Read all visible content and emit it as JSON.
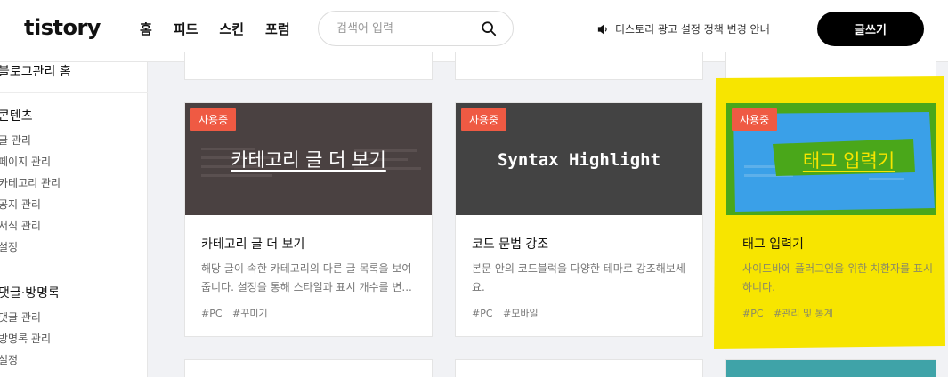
{
  "header": {
    "logo": "tistory",
    "nav": [
      "홈",
      "피드",
      "스킨",
      "포럼"
    ],
    "search_placeholder": "검색어 입력",
    "notice": "티스토리 광고 설정 정책 변경 안내",
    "write_label": "글쓰기"
  },
  "sidebar": {
    "home": "블로그관리 홈",
    "sections": [
      {
        "title": "콘텐츠",
        "items": [
          "글 관리",
          "페이지 관리",
          "카테고리 관리",
          "공지 관리",
          "서식 관리",
          "설정"
        ]
      },
      {
        "title": "댓글·방명록",
        "items": [
          "댓글 관리",
          "방명록 관리",
          "설정"
        ]
      }
    ]
  },
  "cards": [
    {
      "badge": "사용중",
      "thumb_title": "카테고리 글 더 보기",
      "title": "카테고리 글 더 보기",
      "desc": "해당 글이 속한 카테고리의 다른 글 목록을 보여줍니다. 설정을 통해 스타일과 표시 개수를 변...",
      "tags": [
        "#PC",
        "#꾸미기"
      ]
    },
    {
      "badge": "사용중",
      "thumb_title": "Syntax Highlight",
      "title": "코드 문법 강조",
      "desc": "본문 안의 코드블럭을 다양한 테마로 강조해보세요.",
      "tags": [
        "#PC",
        "#모바일"
      ]
    },
    {
      "badge": "사용중",
      "thumb_title": "태그 입력기",
      "title": "태그 입력기",
      "desc": "사이드바에 플러그인을 위한 치환자를 표시하니다.",
      "tags": [
        "#PC",
        "#관리 및 통계"
      ]
    }
  ],
  "colors": {
    "badge": "#ef5a43",
    "highlight_yellow": "#f7e500",
    "highlight_blue": "#3aa0e8",
    "highlight_green": "#4aa71a"
  }
}
